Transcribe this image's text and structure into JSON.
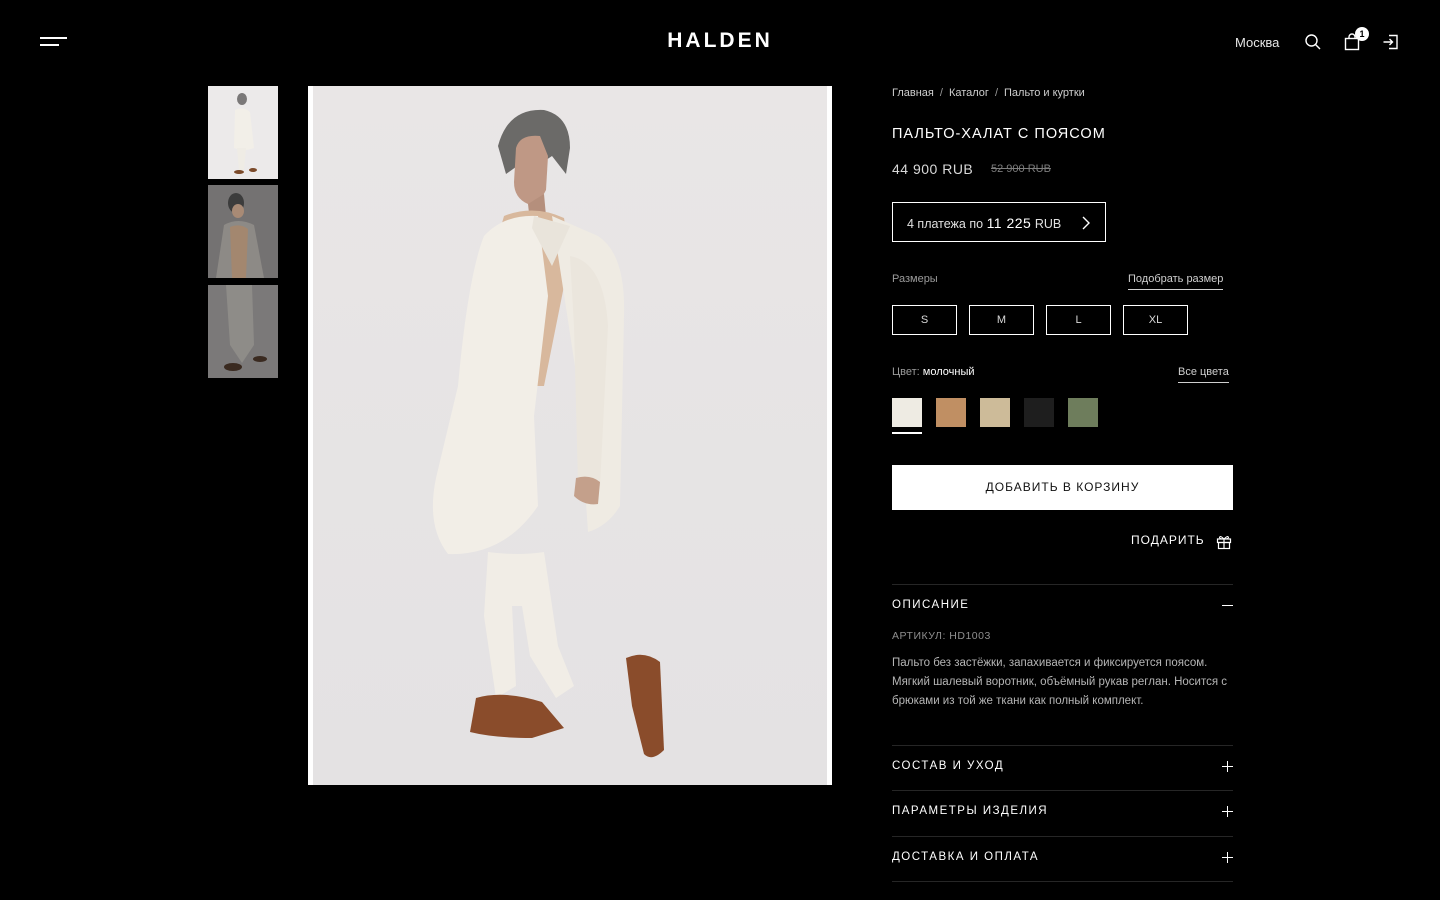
{
  "header": {
    "logo": "HALDEN",
    "city": "Москва",
    "cart_count": "1",
    "icons": [
      "menu-icon",
      "search-icon",
      "cart-icon",
      "login-icon"
    ]
  },
  "breadcrumbs": [
    "Главная",
    "Каталог",
    "Пальто и куртки"
  ],
  "product": {
    "title": "ПАЛЬТО-ХАЛАТ С ПОЯСОМ",
    "price": "44 900 RUB",
    "old_price": "52 900 RUB",
    "installment": {
      "prefix": "4 платежа по",
      "amount": "11 225",
      "currency": "RUB"
    },
    "sizes_label": "Размеры",
    "size_guide": "Подобрать размер",
    "sizes": [
      "S",
      "M",
      "L",
      "XL"
    ],
    "color_label": "Цвет:",
    "color_value": "молочный",
    "all_colors": "Все цвета",
    "colors": [
      "#eeebe3",
      "#c08f63",
      "#cdbb99",
      "#1e1e1e",
      "#6e7d5c"
    ],
    "selected_color": 0,
    "add_to_cart": "ДОБАВИТЬ В КОРЗИНУ",
    "gift": "ПОДАРИТЬ",
    "sections": {
      "description": {
        "title": "ОПИСАНИЕ",
        "sku": "АРТИКУЛ: HD1003",
        "text": "Пальто без застёжки, запахивается и фиксируется поясом. Мягкий шалевый воротник, объёмный рукав реглан. Носится с брюками из той же ткани как полный комплект."
      },
      "composition": "СОСТАВ И УХОД",
      "parameters": "ПАРАМЕТРЫ ИЗДЕЛИЯ",
      "delivery": "ДОСТАВКА И ОПЛАТА"
    }
  },
  "gallery": {
    "thumb_count": 3,
    "active_thumb": 0
  }
}
